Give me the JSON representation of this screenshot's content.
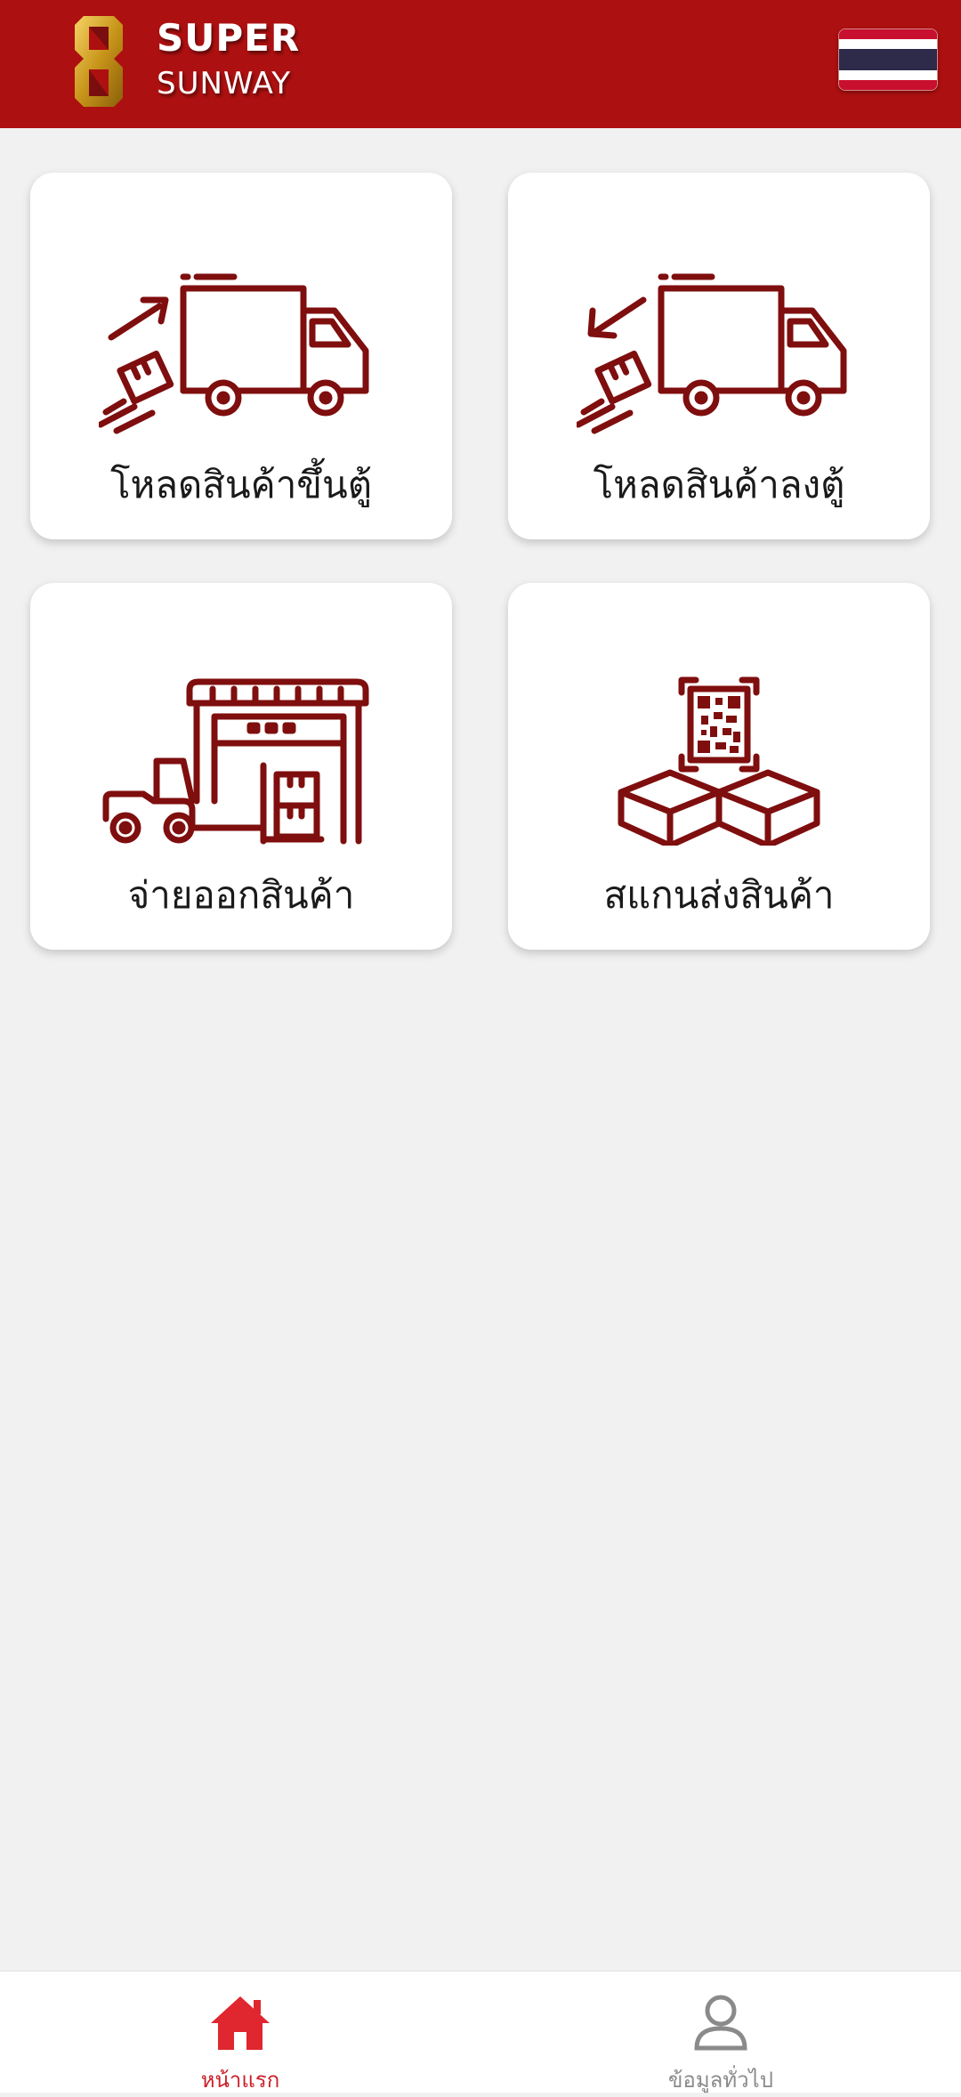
{
  "header": {
    "brand_line1": "SUPER",
    "brand_line2": "SUNWAY",
    "logo_icon": "super-8-logo",
    "language_flag": "thai-flag-icon",
    "colors": {
      "bar": "#ad1010",
      "logo_gold": "#d4a017"
    }
  },
  "menu": {
    "items": [
      {
        "label": "โหลดสินค้าขึ้นตู้",
        "icon": "truck-load-up-icon"
      },
      {
        "label": "โหลดสินค้าลงตู้",
        "icon": "truck-unload-icon"
      },
      {
        "label": "จ่ายออกสินค้า",
        "icon": "warehouse-forklift-icon"
      },
      {
        "label": "สแกนส่งสินค้า",
        "icon": "qr-boxes-icon"
      }
    ],
    "icon_color": "#7f0e0e"
  },
  "bottom_nav": {
    "items": [
      {
        "label": "หน้าแรก",
        "icon": "home-icon",
        "active": true,
        "color": "#e0262e"
      },
      {
        "label": "ข้อมูลทั่วไป",
        "icon": "person-icon",
        "active": false,
        "color": "#8a8a8a"
      }
    ]
  }
}
